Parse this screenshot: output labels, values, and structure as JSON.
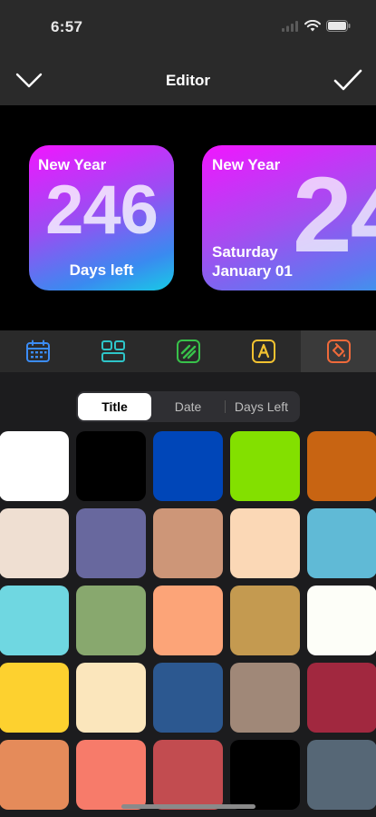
{
  "status_bar": {
    "time": "6:57"
  },
  "nav": {
    "title": "Editor"
  },
  "preview": {
    "small": {
      "title": "New Year",
      "number": "246",
      "caption": "Days left"
    },
    "medium": {
      "title": "New Year",
      "number": "24",
      "day": "Saturday",
      "date": "January 01"
    }
  },
  "tabs": [
    {
      "icon": "calendar-icon",
      "color": "#3b8cf5"
    },
    {
      "icon": "layout-icon",
      "color": "#2ec5c8"
    },
    {
      "icon": "stripes-icon",
      "color": "#38c24a"
    },
    {
      "icon": "text-a-icon",
      "color": "#f2c230"
    },
    {
      "icon": "paint-bucket-icon",
      "color": "#f06a3a",
      "active": true
    }
  ],
  "segments": {
    "items": [
      "Title",
      "Date",
      "Days Left"
    ],
    "selected": "Title"
  },
  "swatches": [
    [
      "#ffffff",
      "#000000",
      "#0046b8",
      "#83e000",
      "#c86412"
    ],
    [
      "#efdfd2",
      "#68689e",
      "#cd9678",
      "#fbd8b6",
      "#60bad6"
    ],
    [
      "#6fd7e1",
      "#88a86e",
      "#fca478",
      "#c49a50",
      "#fdfef8"
    ],
    [
      "#fdd12f",
      "#fbe6bc",
      "#2c5890",
      "#a08878",
      "#a1283f"
    ],
    [
      "#e58b5a",
      "#f77b6a",
      "#c24c50",
      "#000000",
      "#566776"
    ]
  ]
}
